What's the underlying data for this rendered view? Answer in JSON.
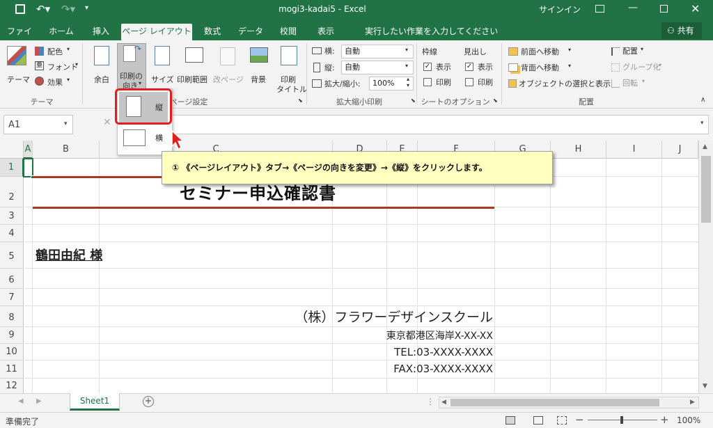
{
  "window": {
    "file_title": "mogi3-kadai5  -  Excel",
    "signin": "サインイン"
  },
  "tabs": {
    "file": "ファイル",
    "home": "ホーム",
    "insert": "挿入",
    "page_layout": "ページ レイアウト",
    "formulas": "数式",
    "data": "データ",
    "review": "校閲",
    "view": "表示",
    "tell_me": "実行したい作業を入力してください",
    "share": "共有"
  },
  "ribbon": {
    "theme": {
      "themes": "テーマ",
      "colors": "配色",
      "fonts": "フォント",
      "effects": "効果",
      "group": "テーマ"
    },
    "page_setup": {
      "margins": "余白",
      "orientation_1": "印刷の",
      "orientation_2": "向き",
      "size": "サイズ",
      "print_area": "印刷範囲",
      "breaks": "改ページ",
      "background": "背景",
      "print_titles_1": "印刷",
      "print_titles_2": "タイトル",
      "group": "ページ設定"
    },
    "scale": {
      "width_label": "横:",
      "width_value": "自動",
      "height_label": "縦:",
      "height_value": "自動",
      "scale_label": "拡大/縮小:",
      "scale_value": "100%",
      "group": "拡大縮小印刷"
    },
    "sheet_options": {
      "gridlines": "枠線",
      "headings": "見出し",
      "view": "表示",
      "print": "印刷",
      "group": "シートのオプション"
    },
    "arrange": {
      "bring_forward": "前面へ移動",
      "send_backward": "背面へ移動",
      "selection_pane": "オブジェクトの選択と表示",
      "align": "配置",
      "group_btn": "グループ化",
      "rotate": "回転",
      "group": "配置"
    }
  },
  "orientation_menu": {
    "portrait": "縦",
    "landscape": "横"
  },
  "formula_bar": {
    "name_box": "A1"
  },
  "grid": {
    "columns": [
      "A",
      "B",
      "C",
      "D",
      "E",
      "F",
      "G",
      "H",
      "I",
      "J"
    ],
    "rows": [
      "1",
      "2",
      "3",
      "4",
      "5",
      "6",
      "7",
      "8",
      "9",
      "10",
      "11",
      "12"
    ],
    "title": "セミナー申込確認書",
    "recipient": "鶴田由紀 様",
    "company": "（株）フラワーデザインスクール",
    "address": "東京都港区海岸X-XX-XX",
    "tel": "TEL:03-XXXX-XXXX",
    "fax": "FAX:03-XXXX-XXXX"
  },
  "callout": "① 《ページレイアウト》タブ→《ページの向きを変更》→《縦》をクリックします。",
  "sheet_tab": "Sheet1",
  "status": {
    "ready": "準備完了",
    "zoom": "100%"
  },
  "colors": {
    "excel_green": "#217346",
    "highlight_red": "#e02020",
    "callout_bg": "#ffffc0",
    "title_rule": "#a63a1c"
  }
}
